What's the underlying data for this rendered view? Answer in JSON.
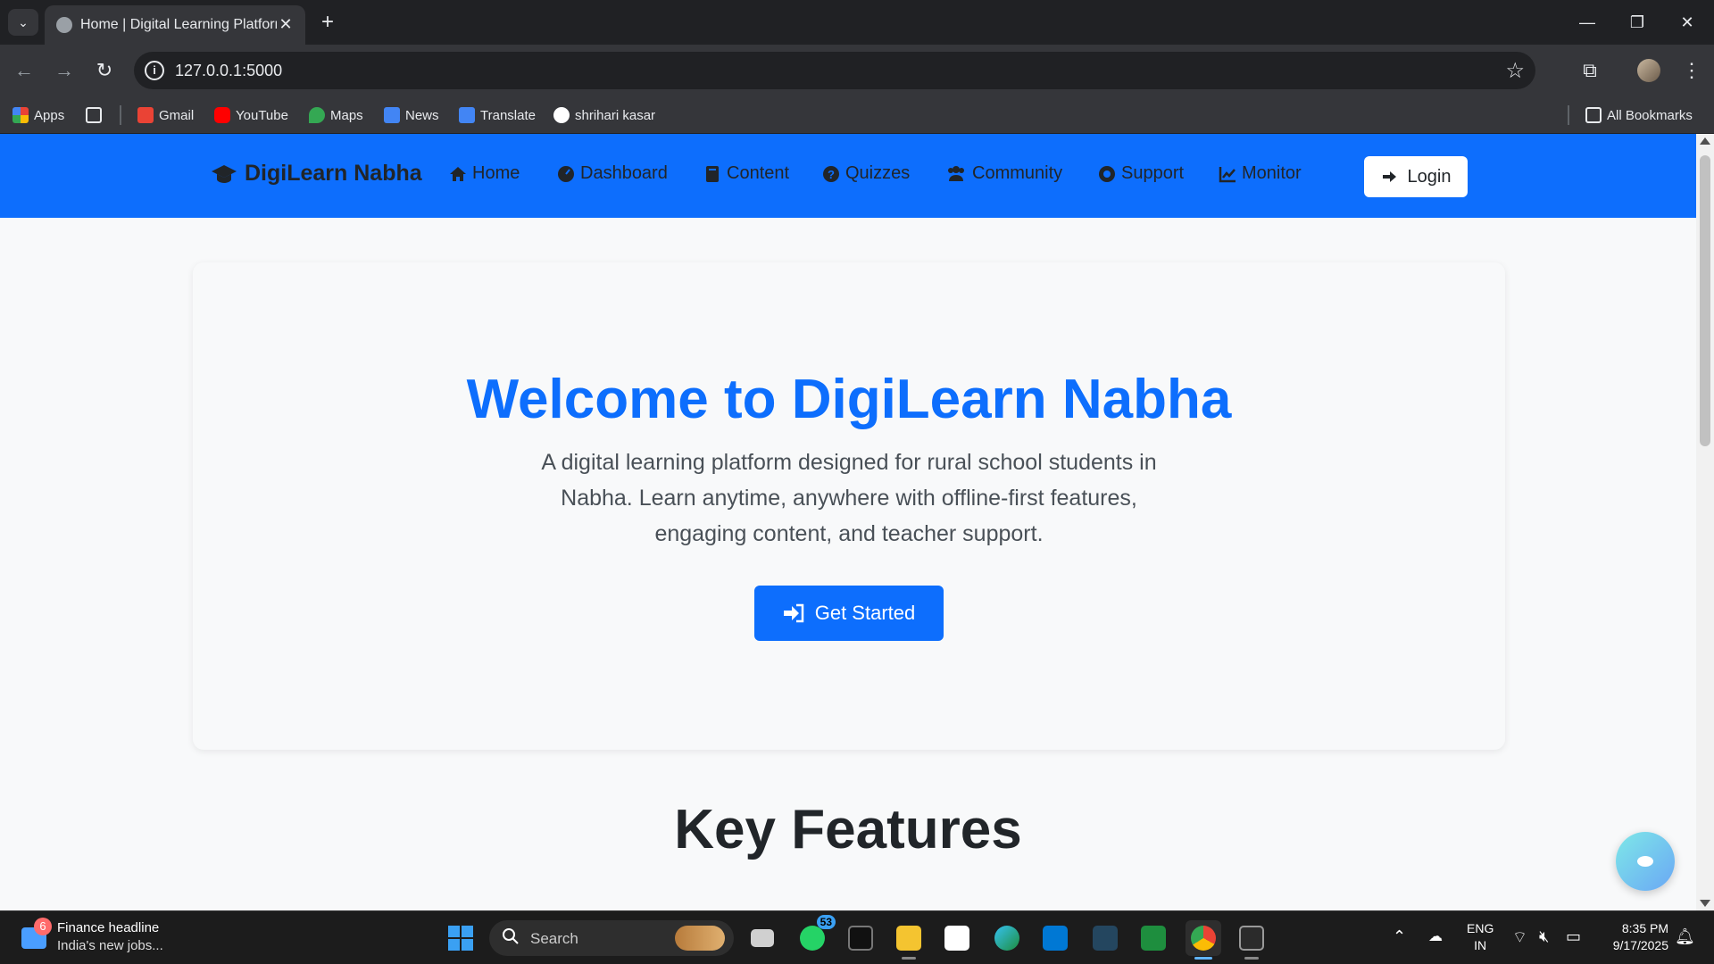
{
  "browser": {
    "tab_title": "Home | Digital Learning Platform",
    "url": "127.0.0.1:5000",
    "bookmarks": [
      {
        "label": "Apps",
        "icon": "apps-grid-icon",
        "color": "#ea4335"
      },
      {
        "label": "Gmail",
        "icon": "gmail-icon",
        "color": "#ea4335"
      },
      {
        "label": "YouTube",
        "icon": "youtube-icon",
        "color": "#ff0000"
      },
      {
        "label": "Maps",
        "icon": "maps-icon",
        "color": "#34a853"
      },
      {
        "label": "News",
        "icon": "news-icon",
        "color": "#4285f4"
      },
      {
        "label": "Translate",
        "icon": "translate-icon",
        "color": "#4285f4"
      },
      {
        "label": "shrihari kasar",
        "icon": "github-icon",
        "color": "#ffffff"
      }
    ],
    "all_bookmarks_label": "All Bookmarks"
  },
  "navbar": {
    "brand": "DigiLearn Nabha",
    "links": [
      "Home",
      "Dashboard",
      "Content",
      "Quizzes",
      "Community",
      "Support",
      "Monitor"
    ],
    "login_label": "Login",
    "bg_color": "#0d6efd"
  },
  "hero": {
    "title": "Welcome to DigiLearn Nabha",
    "description": "A digital learning platform designed for rural school students in Nabha. Learn anytime, anywhere with offline-first features, engaging content, and teacher support.",
    "cta_label": "Get Started",
    "accent": "#0d6efd"
  },
  "features": {
    "title": "Key Features"
  },
  "taskbar": {
    "news_badge": "6",
    "news_title": "Finance headline",
    "news_subtitle": "India's new jobs...",
    "search_label": "Search",
    "whatsapp_badge": "53",
    "lang_line1": "ENG",
    "lang_line2": "IN",
    "time": "8:35 PM",
    "date": "9/17/2025"
  }
}
